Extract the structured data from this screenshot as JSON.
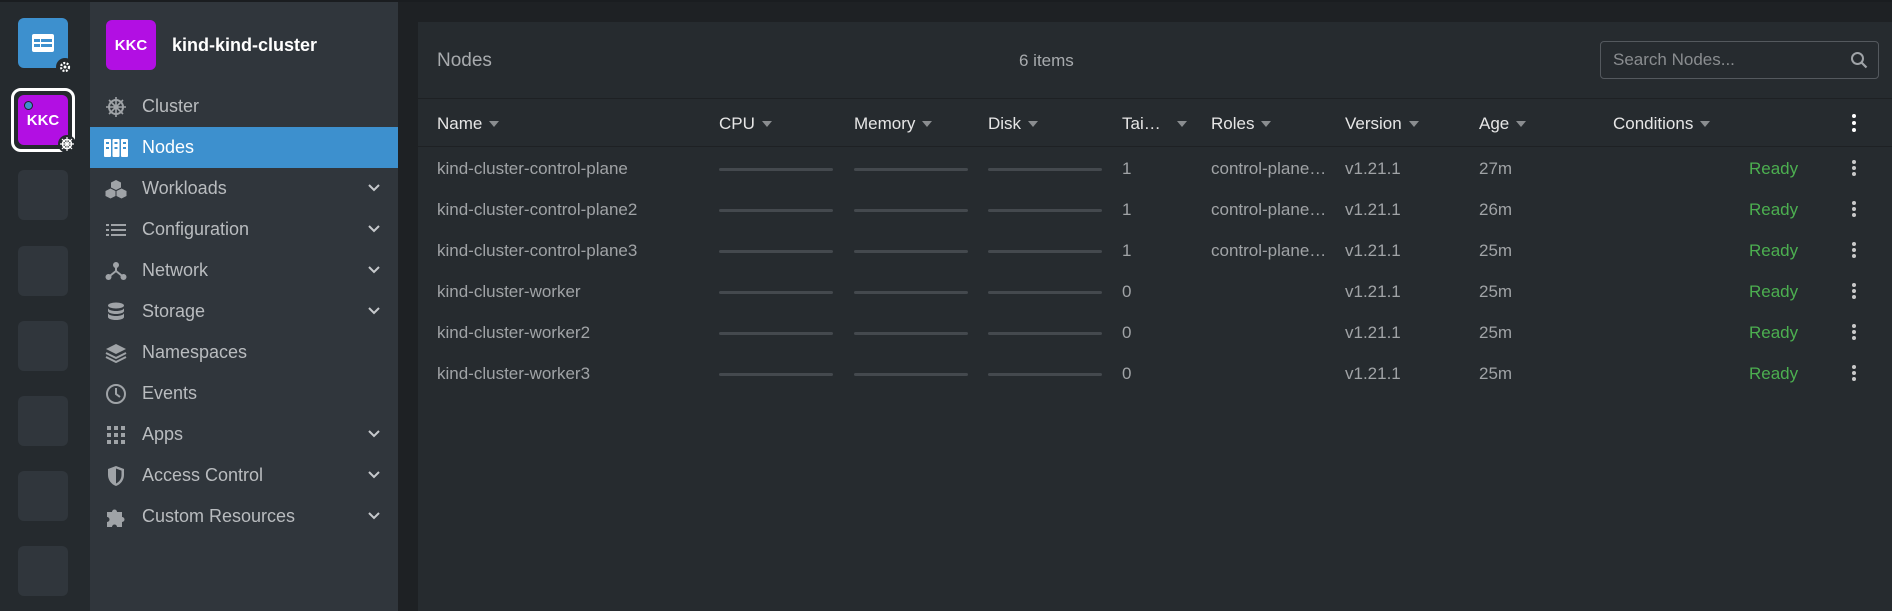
{
  "rail": {
    "home_icon": "table-icon",
    "home_badge_icon": "gear-icon",
    "active_cluster_initials": "KKC",
    "active_cluster_badge_icon": "helm-wheel-icon",
    "empty_slots": 6
  },
  "sidebar": {
    "cluster_initials": "KKC",
    "cluster_name": "kind-kind-cluster",
    "items": [
      {
        "label": "Cluster",
        "icon": "helm-wheel-icon",
        "expandable": false,
        "active": false
      },
      {
        "label": "Nodes",
        "icon": "server-icon",
        "expandable": false,
        "active": true
      },
      {
        "label": "Workloads",
        "icon": "cubes-icon",
        "expandable": true,
        "active": false
      },
      {
        "label": "Configuration",
        "icon": "list-icon",
        "expandable": true,
        "active": false
      },
      {
        "label": "Network",
        "icon": "network-icon",
        "expandable": true,
        "active": false
      },
      {
        "label": "Storage",
        "icon": "database-icon",
        "expandable": true,
        "active": false
      },
      {
        "label": "Namespaces",
        "icon": "layers-icon",
        "expandable": false,
        "active": false
      },
      {
        "label": "Events",
        "icon": "clock-icon",
        "expandable": false,
        "active": false
      },
      {
        "label": "Apps",
        "icon": "apps-grid-icon",
        "expandable": true,
        "active": false
      },
      {
        "label": "Access Control",
        "icon": "shield-icon",
        "expandable": true,
        "active": false
      },
      {
        "label": "Custom Resources",
        "icon": "puzzle-icon",
        "expandable": true,
        "active": false
      }
    ]
  },
  "main": {
    "title": "Nodes",
    "count": "6 items",
    "search": {
      "placeholder": "Search Nodes...",
      "value": ""
    },
    "columns": [
      "Name",
      "CPU",
      "Memory",
      "Disk",
      "Tai…",
      "Roles",
      "Version",
      "Age",
      "Conditions"
    ],
    "rows": [
      {
        "name": "kind-cluster-control-plane",
        "cpu": 0,
        "memory": 0,
        "disk": 0,
        "taints": "1",
        "roles": "control-plane…",
        "version": "v1.21.1",
        "age": "27m",
        "conditions": "Ready"
      },
      {
        "name": "kind-cluster-control-plane2",
        "cpu": 0,
        "memory": 0,
        "disk": 0,
        "taints": "1",
        "roles": "control-plane…",
        "version": "v1.21.1",
        "age": "26m",
        "conditions": "Ready"
      },
      {
        "name": "kind-cluster-control-plane3",
        "cpu": 0,
        "memory": 0,
        "disk": 0,
        "taints": "1",
        "roles": "control-plane…",
        "version": "v1.21.1",
        "age": "25m",
        "conditions": "Ready"
      },
      {
        "name": "kind-cluster-worker",
        "cpu": 0,
        "memory": 0,
        "disk": 0,
        "taints": "0",
        "roles": "",
        "version": "v1.21.1",
        "age": "25m",
        "conditions": "Ready"
      },
      {
        "name": "kind-cluster-worker2",
        "cpu": 0,
        "memory": 0,
        "disk": 0,
        "taints": "0",
        "roles": "",
        "version": "v1.21.1",
        "age": "25m",
        "conditions": "Ready"
      },
      {
        "name": "kind-cluster-worker3",
        "cpu": 0,
        "memory": 0,
        "disk": 0,
        "taints": "0",
        "roles": "",
        "version": "v1.21.1",
        "age": "25m",
        "conditions": "Ready"
      }
    ]
  },
  "colors": {
    "accent": "#3d90ce",
    "cluster_avatar": "#b20fe3",
    "ready_status": "#4caf50"
  }
}
